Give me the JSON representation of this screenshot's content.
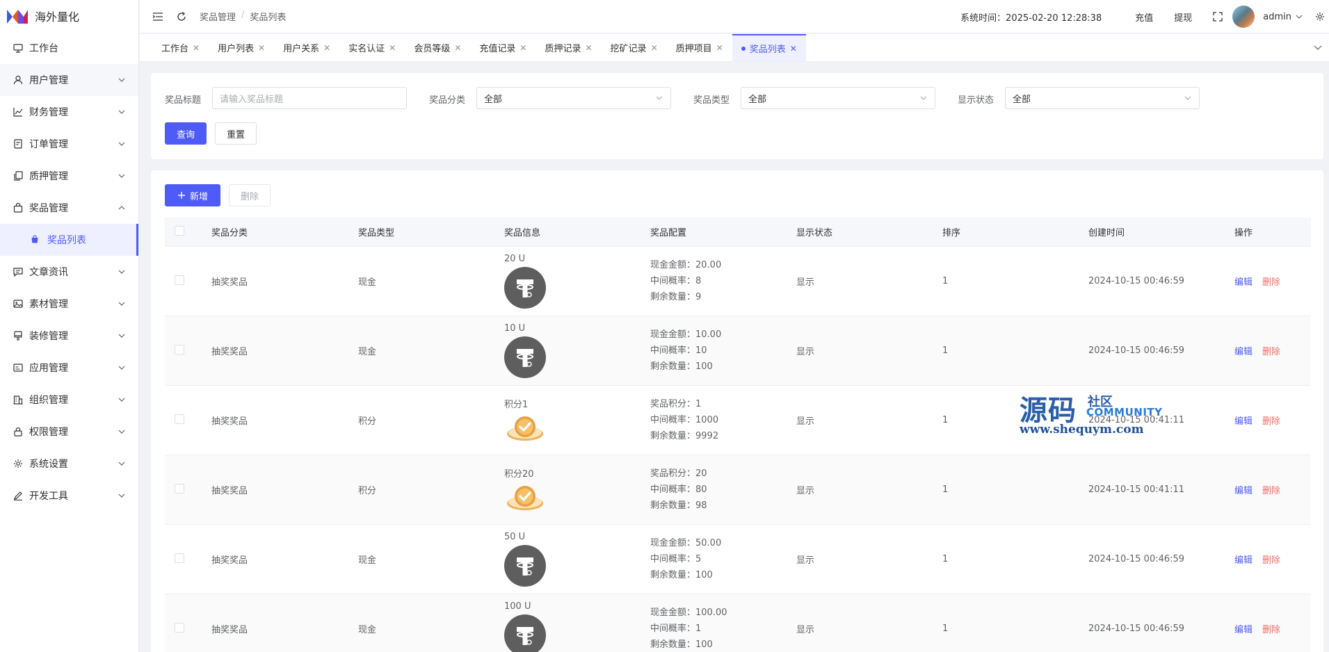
{
  "app": {
    "title": "海外量化"
  },
  "sidebar": {
    "items": [
      {
        "label": "工作台",
        "icon": "monitor-icon",
        "has_children": false
      },
      {
        "label": "用户管理",
        "icon": "user-icon",
        "has_children": true
      },
      {
        "label": "财务管理",
        "icon": "chart-icon",
        "has_children": true
      },
      {
        "label": "订单管理",
        "icon": "order-icon",
        "has_children": true
      },
      {
        "label": "质押管理",
        "icon": "copy-icon",
        "has_children": true
      },
      {
        "label": "奖品管理",
        "icon": "bag-icon",
        "has_children": true,
        "expanded": true
      },
      {
        "label": "文章资讯",
        "icon": "message-icon",
        "has_children": true
      },
      {
        "label": "素材管理",
        "icon": "image-icon",
        "has_children": true
      },
      {
        "label": "装修管理",
        "icon": "brush-icon",
        "has_children": true
      },
      {
        "label": "应用管理",
        "icon": "app-icon",
        "has_children": true
      },
      {
        "label": "组织管理",
        "icon": "building-icon",
        "has_children": true
      },
      {
        "label": "权限管理",
        "icon": "lock-icon",
        "has_children": true
      },
      {
        "label": "系统设置",
        "icon": "gear-icon",
        "has_children": true
      },
      {
        "label": "开发工具",
        "icon": "pen-icon",
        "has_children": true
      }
    ],
    "active_sub": {
      "label": "奖品列表",
      "icon": "shopping-bag-icon"
    }
  },
  "header": {
    "breadcrumb": [
      "奖品管理",
      "奖品列表"
    ],
    "breadcrumb_sep": "/",
    "system_time": "系统时间：2025-02-20 12:28:38",
    "recharge": "充值",
    "withdraw": "提现",
    "user": "admin"
  },
  "tabs": [
    {
      "label": "工作台",
      "active": false
    },
    {
      "label": "用户列表",
      "active": false
    },
    {
      "label": "用户关系",
      "active": false
    },
    {
      "label": "实名认证",
      "active": false
    },
    {
      "label": "会员等级",
      "active": false
    },
    {
      "label": "充值记录",
      "active": false
    },
    {
      "label": "质押记录",
      "active": false
    },
    {
      "label": "挖矿记录",
      "active": false
    },
    {
      "label": "质押项目",
      "active": false
    },
    {
      "label": "奖品列表",
      "active": true
    }
  ],
  "filters": {
    "title_label": "奖品标题",
    "title_placeholder": "请输入奖品标题",
    "category_label": "奖品分类",
    "category_value": "全部",
    "type_label": "奖品类型",
    "type_value": "全部",
    "status_label": "显示状态",
    "status_value": "全部",
    "query": "查询",
    "reset": "重置"
  },
  "toolbar": {
    "add": "新增",
    "delete": "删除"
  },
  "table": {
    "columns": [
      "奖品分类",
      "奖品类型",
      "奖品信息",
      "奖品配置",
      "显示状态",
      "排序",
      "创建时间",
      "操作"
    ],
    "edit_label": "编辑",
    "delete_label": "删除",
    "rows": [
      {
        "category": "抽奖奖品",
        "type": "现金",
        "info_title": "20 U",
        "icon": "usdt-coin-icon",
        "conf": [
          "现金金额：20.00",
          "中间概率：8",
          "剩余数量：9"
        ],
        "status": "显示",
        "sort": "1",
        "created": "2024-10-15 00:46:59"
      },
      {
        "category": "抽奖奖品",
        "type": "现金",
        "info_title": "10 U",
        "icon": "usdt-coin-icon",
        "conf": [
          "现金金额：10.00",
          "中间概率：10",
          "剩余数量：100"
        ],
        "status": "显示",
        "sort": "1",
        "created": "2024-10-15 00:46:59"
      },
      {
        "category": "抽奖奖品",
        "type": "积分",
        "info_title": "积分1",
        "icon": "points-coin-icon",
        "conf": [
          "奖品积分：1",
          "中间概率：1000",
          "剩余数量：9992"
        ],
        "status": "显示",
        "sort": "1",
        "created": "2024-10-15 00:41:11"
      },
      {
        "category": "抽奖奖品",
        "type": "积分",
        "info_title": "积分20",
        "icon": "points-coin-icon",
        "conf": [
          "奖品积分：20",
          "中间概率：80",
          "剩余数量：98"
        ],
        "status": "显示",
        "sort": "1",
        "created": "2024-10-15 00:41:11"
      },
      {
        "category": "抽奖奖品",
        "type": "现金",
        "info_title": "50 U",
        "icon": "usdt-coin-icon",
        "conf": [
          "现金金额：50.00",
          "中间概率：5",
          "剩余数量：100"
        ],
        "status": "显示",
        "sort": "1",
        "created": "2024-10-15 00:46:59"
      },
      {
        "category": "抽奖奖品",
        "type": "现金",
        "info_title": "100 U",
        "icon": "usdt-coin-icon",
        "conf": [
          "现金金额：100.00",
          "中间概率：1",
          "剩余数量：100"
        ],
        "status": "显示",
        "sort": "1",
        "created": "2024-10-15 00:46:59"
      }
    ]
  },
  "watermark": {
    "big": "源码",
    "small": "社区",
    "community": "COMMUNITY",
    "url": "www.shequym.com"
  },
  "colors": {
    "primary": "#4f5bf6",
    "danger": "#f56c6c",
    "watermark": "#2a5ea8"
  }
}
